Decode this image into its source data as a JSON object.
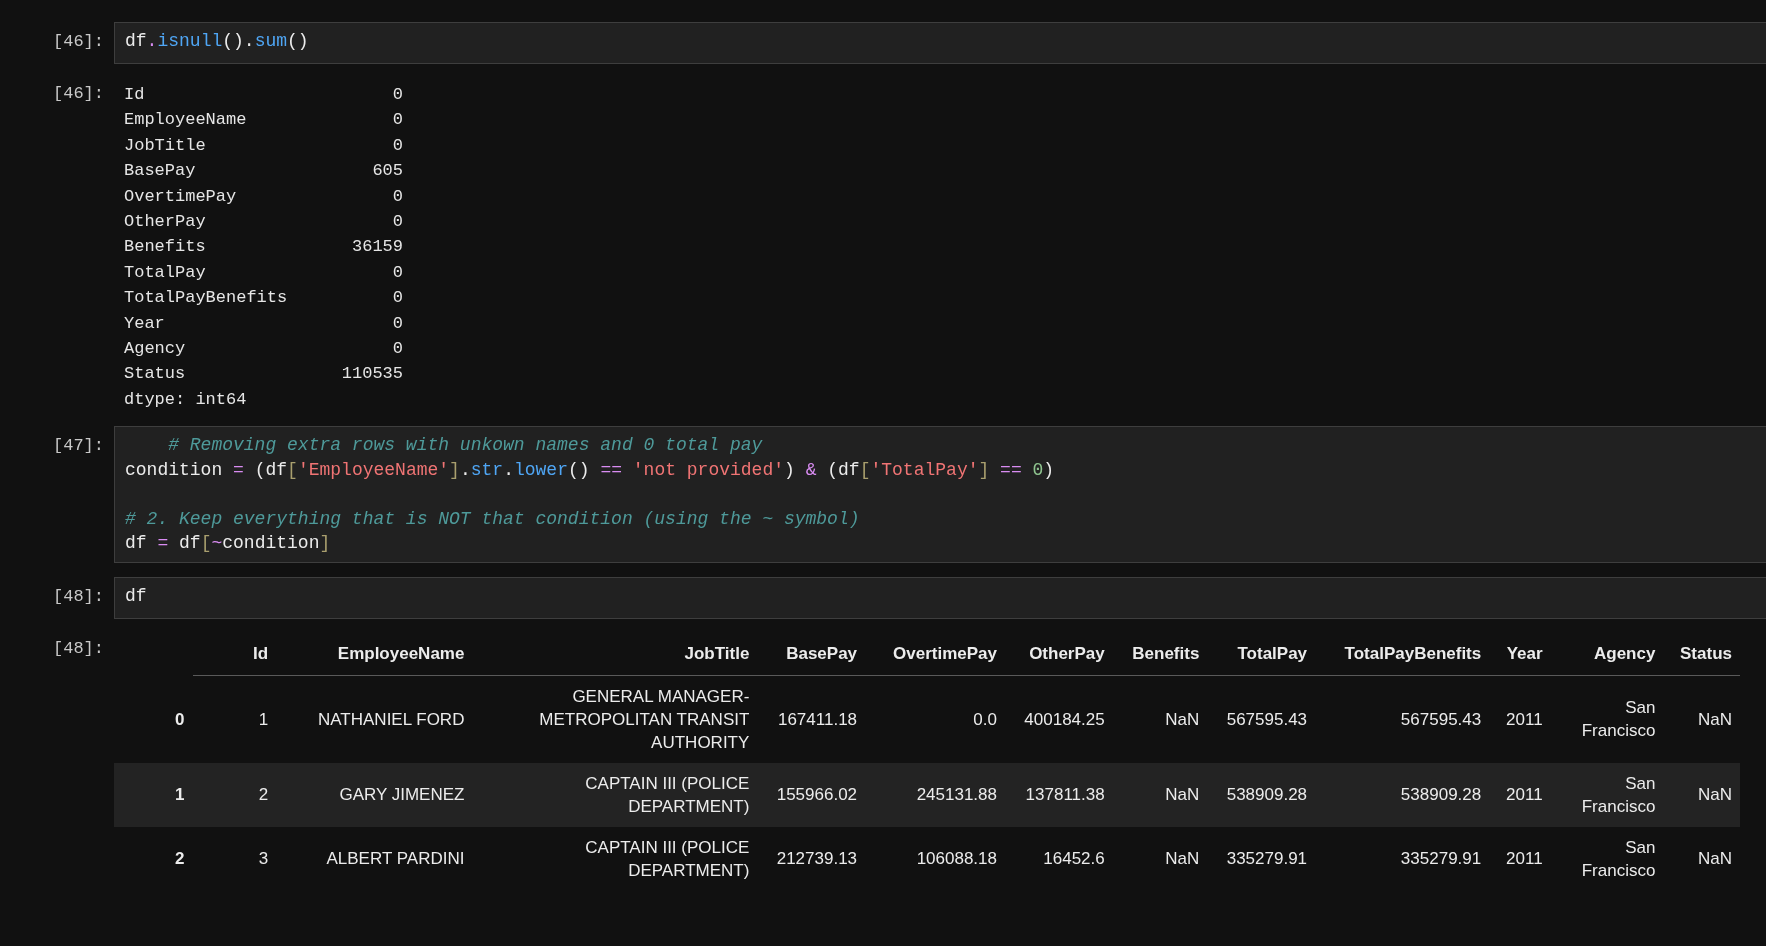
{
  "cells": [
    {
      "prompt": "[46]:",
      "code": [
        {
          "kind": "code",
          "tokens": [
            {
              "t": "df",
              "kind": "name"
            },
            {
              "t": ".",
              "kind": "op"
            },
            {
              "t": "isnull",
              "kind": "func"
            },
            {
              "t": "().",
              "kind": "name"
            },
            {
              "t": "sum",
              "kind": "func"
            },
            {
              "t": "()",
              "kind": "name"
            }
          ]
        }
      ],
      "output": {
        "kind": "series",
        "prompt": "[46]:",
        "rows": [
          {
            "name": "Id",
            "value": "0"
          },
          {
            "name": "EmployeeName",
            "value": "0"
          },
          {
            "name": "JobTitle",
            "value": "0"
          },
          {
            "name": "BasePay",
            "value": "605"
          },
          {
            "name": "OvertimePay",
            "value": "0"
          },
          {
            "name": "OtherPay",
            "value": "0"
          },
          {
            "name": "Benefits",
            "value": "36159"
          },
          {
            "name": "TotalPay",
            "value": "0"
          },
          {
            "name": "TotalPayBenefits",
            "value": "0"
          },
          {
            "name": "Year",
            "value": "0"
          },
          {
            "name": "Agency",
            "value": "0"
          },
          {
            "name": "Status",
            "value": "110535"
          }
        ],
        "footer": "dtype: int64"
      }
    },
    {
      "prompt": "[47]:",
      "code": [
        {
          "kind": "code",
          "tokens": [
            {
              "t": "    # Removing extra rows with unkown names and 0 total pay",
              "kind": "comment"
            }
          ]
        },
        {
          "kind": "code",
          "tokens": [
            {
              "t": "condition ",
              "kind": "name"
            },
            {
              "t": "=",
              "kind": "op"
            },
            {
              "t": " (df",
              "kind": "name"
            },
            {
              "t": "[",
              "kind": "bracket"
            },
            {
              "t": "'EmployeeName'",
              "kind": "str"
            },
            {
              "t": "]",
              "kind": "bracket"
            },
            {
              "t": ".",
              "kind": "name"
            },
            {
              "t": "str",
              "kind": "func"
            },
            {
              "t": ".",
              "kind": "name"
            },
            {
              "t": "lower",
              "kind": "func"
            },
            {
              "t": "() ",
              "kind": "name"
            },
            {
              "t": "== ",
              "kind": "op"
            },
            {
              "t": "'not provided'",
              "kind": "str"
            },
            {
              "t": ") ",
              "kind": "name"
            },
            {
              "t": "&",
              "kind": "op"
            },
            {
              "t": " (df",
              "kind": "name"
            },
            {
              "t": "[",
              "kind": "bracket"
            },
            {
              "t": "'TotalPay'",
              "kind": "str"
            },
            {
              "t": "] ",
              "kind": "bracket"
            },
            {
              "t": "== ",
              "kind": "op"
            },
            {
              "t": "0",
              "kind": "num"
            },
            {
              "t": ")",
              "kind": "name"
            }
          ]
        },
        {
          "kind": "blank"
        },
        {
          "kind": "code",
          "tokens": [
            {
              "t": "# 2. Keep everything that is NOT that condition (using the ~ symbol)",
              "kind": "comment"
            }
          ]
        },
        {
          "kind": "code",
          "tokens": [
            {
              "t": "df ",
              "kind": "name"
            },
            {
              "t": "=",
              "kind": "op"
            },
            {
              "t": " df",
              "kind": "name"
            },
            {
              "t": "[",
              "kind": "bracket"
            },
            {
              "t": "~",
              "kind": "op"
            },
            {
              "t": "condition",
              "kind": "name"
            },
            {
              "t": "]",
              "kind": "bracket"
            }
          ]
        }
      ]
    },
    {
      "prompt": "[48]:",
      "code": [
        {
          "kind": "code",
          "tokens": [
            {
              "t": "df",
              "kind": "name"
            }
          ]
        }
      ],
      "output": {
        "kind": "table",
        "prompt": "[48]:",
        "columns": [
          "Id",
          "EmployeeName",
          "JobTitle",
          "BasePay",
          "OvertimePay",
          "OtherPay",
          "Benefits",
          "TotalPay",
          "TotalPayBenefits",
          "Year",
          "Agency",
          "Status"
        ],
        "rows": [
          {
            "index": "0",
            "cells": [
              "1",
              "NATHANIEL FORD",
              "GENERAL MANAGER-METROPOLITAN TRANSIT AUTHORITY",
              "167411.18",
              "0.0",
              "400184.25",
              "NaN",
              "567595.43",
              "567595.43",
              "2011",
              "San Francisco",
              "NaN"
            ]
          },
          {
            "index": "1",
            "cells": [
              "2",
              "GARY JIMENEZ",
              "CAPTAIN III (POLICE DEPARTMENT)",
              "155966.02",
              "245131.88",
              "137811.38",
              "NaN",
              "538909.28",
              "538909.28",
              "2011",
              "San Francisco",
              "NaN"
            ]
          },
          {
            "index": "2",
            "cells": [
              "3",
              "ALBERT PARDINI",
              "CAPTAIN III (POLICE DEPARTMENT)",
              "212739.13",
              "106088.18",
              "16452.6",
              "NaN",
              "335279.91",
              "335279.91",
              "2011",
              "San Francisco",
              "NaN"
            ]
          }
        ]
      }
    }
  ]
}
